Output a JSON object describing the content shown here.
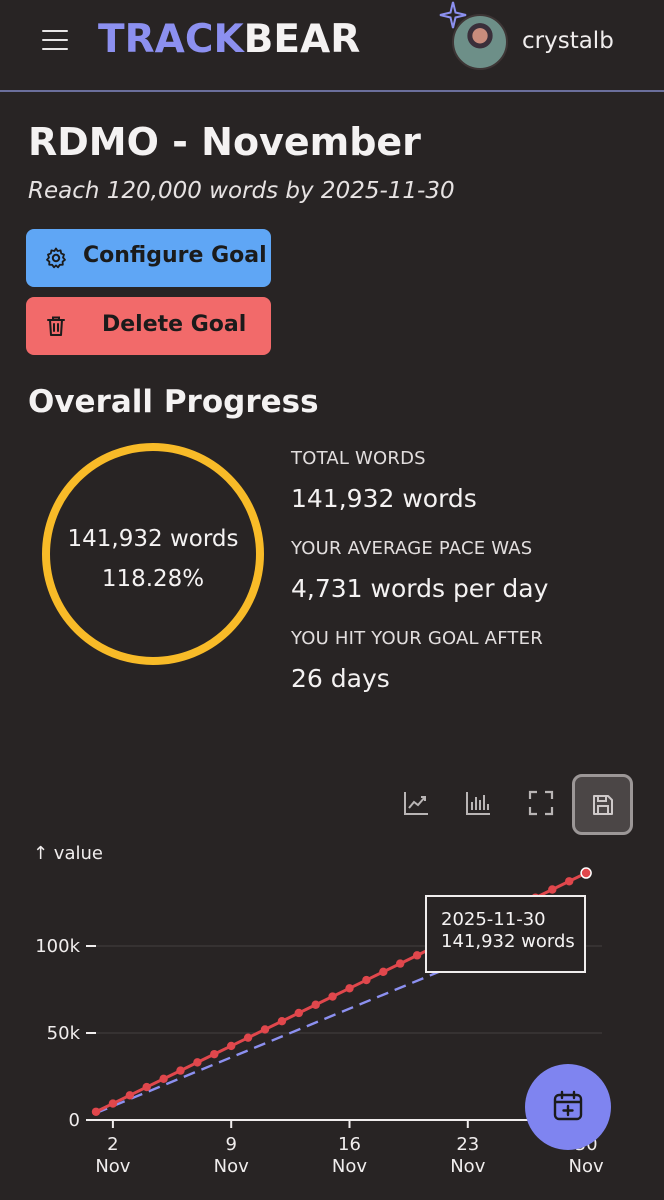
{
  "header": {
    "logo_part1": "TRACK",
    "logo_part2": "BEAR",
    "username": "crystalb"
  },
  "goal": {
    "title": "RDMO - November",
    "subtitle": "Reach 120,000 words by 2025-11-30",
    "configure_label": "Configure Goal",
    "delete_label": "Delete Goal"
  },
  "progress": {
    "section_title": "Overall Progress",
    "ring_words": "141,932 words",
    "ring_percent": "118.28%",
    "percent_value": 118.28,
    "total_label": "TOTAL WORDS",
    "total_value": "141,932 words",
    "pace_label": "YOUR AVERAGE PACE WAS",
    "pace_value": "4,731 words per day",
    "hit_label": "YOU HIT YOUR GOAL AFTER",
    "hit_value": "26 days"
  },
  "colors": {
    "brand": "#8c90f0",
    "configure": "#5fa6f5",
    "delete": "#f26a6a",
    "ring": "#f8bb28",
    "actual_line": "#e0474c",
    "target_line": "#8c90f0"
  },
  "chart_data": {
    "type": "line",
    "ylabel": "↑ value",
    "ylim": [
      0,
      150000
    ],
    "y_ticks": [
      "0",
      "50k",
      "100k"
    ],
    "y_tick_values": [
      0,
      50000,
      100000
    ],
    "x_ticks": [
      {
        "day": 2,
        "top": "2",
        "bottom": "Nov"
      },
      {
        "day": 9,
        "top": "9",
        "bottom": "Nov"
      },
      {
        "day": 16,
        "top": "16",
        "bottom": "Nov"
      },
      {
        "day": 23,
        "top": "23",
        "bottom": "Nov"
      },
      {
        "day": 30,
        "top": "30",
        "bottom": "Nov"
      }
    ],
    "series": [
      {
        "style": "solid-with-markers",
        "x": [
          1,
          2,
          3,
          4,
          5,
          6,
          7,
          8,
          9,
          10,
          11,
          12,
          13,
          14,
          15,
          16,
          17,
          18,
          19,
          20,
          21,
          22,
          23,
          24,
          25,
          26,
          27,
          28,
          29,
          30
        ],
        "values": [
          4731,
          9462,
          14193,
          18924,
          23655,
          28386,
          33117,
          37848,
          42579,
          47310,
          52041,
          56772,
          61503,
          66234,
          70965,
          75696,
          80427,
          85158,
          89889,
          94620,
          99351,
          104082,
          108813,
          113544,
          118275,
          123006,
          127737,
          132468,
          137199,
          141932
        ]
      },
      {
        "style": "dashed",
        "x": [
          1,
          30
        ],
        "values": [
          4000,
          120000
        ]
      }
    ],
    "tooltip": {
      "date": "2025-11-30",
      "value": "141,932 words"
    }
  }
}
